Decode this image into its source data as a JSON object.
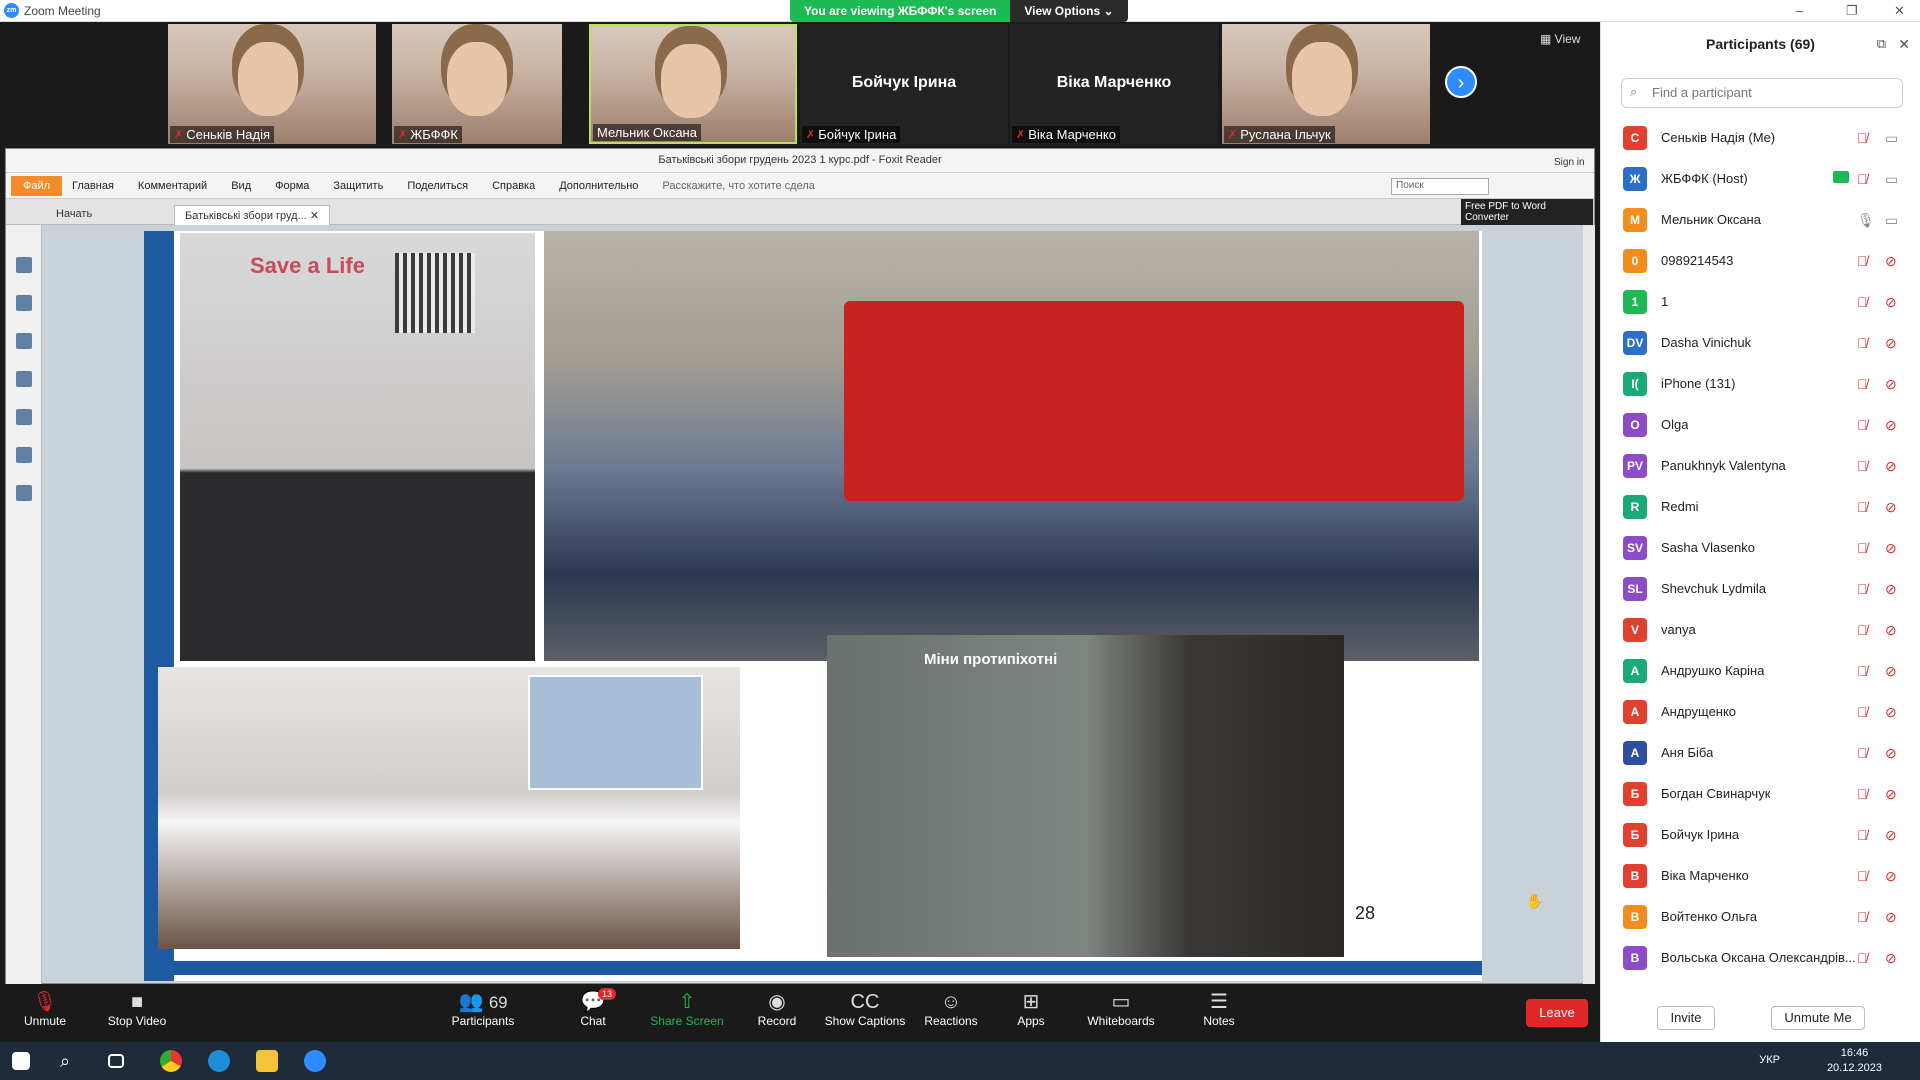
{
  "window": {
    "title": "Zoom Meeting"
  },
  "share_bar": {
    "viewing": "You are viewing ЖБФФК's screen",
    "options": "View Options"
  },
  "videos": [
    {
      "name": "Сеньків Надія"
    },
    {
      "name": "ЖБФФК"
    },
    {
      "name": "Мельник Оксана"
    },
    {
      "name": "Бойчук Ірина",
      "big": "Бойчук Ірина"
    },
    {
      "name": "Віка Марченко",
      "big": "Віка Марченко"
    },
    {
      "name": "Руслана Ільчук"
    }
  ],
  "view_label": "View",
  "foxit": {
    "doc_title": "Батьківські збори грудень 2023 1 курс.pdf - Foxit Reader",
    "menu": [
      "Файл",
      "Главная",
      "Комментарий",
      "Вид",
      "Форма",
      "Защитить",
      "Поделиться",
      "Справка",
      "Дополнительно"
    ],
    "tell": "Расскажите, что хотите сдела",
    "search_placeholder": "Поиск",
    "sign_in": "Sign in",
    "promo": "Free PDF to Word Converter",
    "tabs": [
      "Начать",
      "Батьківські збори груд..."
    ],
    "page_number": "28",
    "img1_text": "Save a Life",
    "img4_text": "Міни протипіхотні"
  },
  "controls": {
    "unmute": "Unmute",
    "stop_video": "Stop Video",
    "participants": "Participants",
    "participants_count": "69",
    "chat": "Chat",
    "chat_badge": "13",
    "share": "Share Screen",
    "record": "Record",
    "captions": "Show Captions",
    "reactions": "Reactions",
    "apps": "Apps",
    "whiteboards": "Whiteboards",
    "notes": "Notes",
    "leave": "Leave"
  },
  "panel": {
    "title": "Participants (69)",
    "find_placeholder": "Find a participant",
    "participants": [
      {
        "initials": "С",
        "name": "Сеньків Надія (Me)",
        "color": "#e0402e",
        "mic": "off",
        "cam": "on"
      },
      {
        "initials": "Ж",
        "name": "ЖБФФК (Host)",
        "color": "#2d6fc7",
        "mic": "off",
        "cam": "on",
        "sharing": true
      },
      {
        "initials": "М",
        "name": "Мельник Оксана",
        "color": "#f28c1c",
        "mic": "on",
        "cam": "on"
      },
      {
        "initials": "0",
        "name": "0989214543",
        "color": "#f28c1c",
        "mic": "off",
        "cam": "off"
      },
      {
        "initials": "1",
        "name": "1",
        "color": "#1db954",
        "mic": "off",
        "cam": "off"
      },
      {
        "initials": "DV",
        "name": "Dasha Vinichuk",
        "color": "#2d6fc7",
        "mic": "off",
        "cam": "off"
      },
      {
        "initials": "I(",
        "name": "iPhone (131)",
        "color": "#1ba87a",
        "mic": "off",
        "cam": "off"
      },
      {
        "initials": "O",
        "name": "Olga",
        "color": "#8c4bc7",
        "mic": "off",
        "cam": "off"
      },
      {
        "initials": "PV",
        "name": "Panukhnyk Valentyna",
        "color": "#8c4bc7",
        "mic": "off",
        "cam": "off"
      },
      {
        "initials": "R",
        "name": "Redmi",
        "color": "#1ba87a",
        "mic": "off",
        "cam": "off"
      },
      {
        "initials": "SV",
        "name": "Sasha Vlasenko",
        "color": "#8c4bc7",
        "mic": "off",
        "cam": "off"
      },
      {
        "initials": "SL",
        "name": "Shevchuk Lydmila",
        "color": "#8c4bc7",
        "mic": "off",
        "cam": "off"
      },
      {
        "initials": "V",
        "name": "vanya",
        "color": "#e0402e",
        "mic": "off",
        "cam": "off"
      },
      {
        "initials": "А",
        "name": "Андрушко Каріна",
        "color": "#1ba87a",
        "mic": "off",
        "cam": "off"
      },
      {
        "initials": "А",
        "name": "Андрущенко",
        "color": "#e0402e",
        "mic": "off",
        "cam": "off"
      },
      {
        "initials": "А",
        "name": "Аня Біба",
        "color": "#2d4fa0",
        "mic": "off",
        "cam": "off"
      },
      {
        "initials": "Б",
        "name": "Богдан Свинарчук",
        "color": "#e0402e",
        "mic": "off",
        "cam": "off"
      },
      {
        "initials": "Б",
        "name": "Бойчук Ірина",
        "color": "#e0402e",
        "mic": "off",
        "cam": "off"
      },
      {
        "initials": "В",
        "name": "Віка Марченко",
        "color": "#e0402e",
        "mic": "off",
        "cam": "off"
      },
      {
        "initials": "В",
        "name": "Войтенко Ольга",
        "color": "#f28c1c",
        "mic": "off",
        "cam": "off"
      },
      {
        "initials": "В",
        "name": "Вольська Оксана Олександрів...",
        "color": "#8c4bc7",
        "mic": "off",
        "cam": "off"
      }
    ],
    "invite": "Invite",
    "unmute_me": "Unmute Me"
  },
  "taskbar": {
    "lang": "УКР",
    "time": "16:46",
    "date": "20.12.2023"
  }
}
